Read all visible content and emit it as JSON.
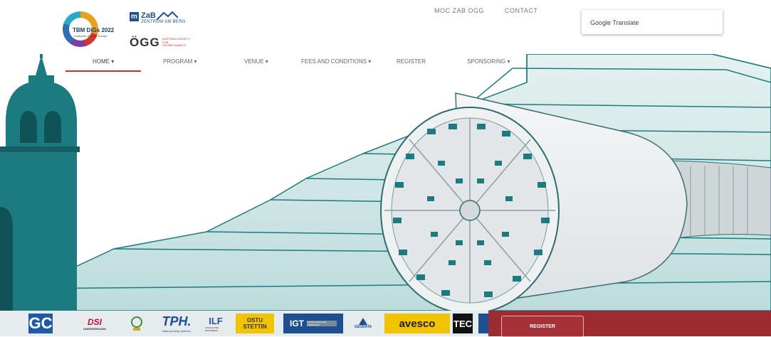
{
  "header": {
    "tbm_logo": {
      "title": "TBM DiGs 2022",
      "subtitle": "Lowlands, Austria, Europe"
    },
    "zab_logo": {
      "title": "ZaB",
      "subtitle": "ZENTRUM AM BERG"
    },
    "ogg_logo": {
      "title": "ÖGG",
      "subtitle": "AUSTRIAN SOCIETY FOR GEOMECHANICS"
    },
    "top_links": [
      "MOC ZAB OGG",
      "CONTACT"
    ],
    "translate_label": "Google Translate"
  },
  "nav": {
    "items": [
      {
        "label": "HOME ▾",
        "active": true
      },
      {
        "label": "PROGRAM ▾",
        "active": false
      },
      {
        "label": "VENUE ▾",
        "active": false
      },
      {
        "label": "FEES AND CONDITIONS ▾",
        "active": false
      },
      {
        "label": "REGISTER",
        "active": false
      },
      {
        "label": "SPONSORING ▾",
        "active": false
      }
    ],
    "active_color": "#d12b2b"
  },
  "hero": {
    "teal": "#1c7b80",
    "pale": "#d3e9e8"
  },
  "sponsors": [
    "GC",
    "DSI",
    "UNDERGROUND",
    "TPH.",
    "waterproofing systems",
    "ILF",
    "CONSULTING ENGINEERS",
    "OSTU",
    "STETTIN",
    "IGT",
    "GEOTECHNIK UND TUNNELBAU",
    "GEODATA",
    "avesco",
    "TEC"
  ],
  "register_button": "REGISTER"
}
